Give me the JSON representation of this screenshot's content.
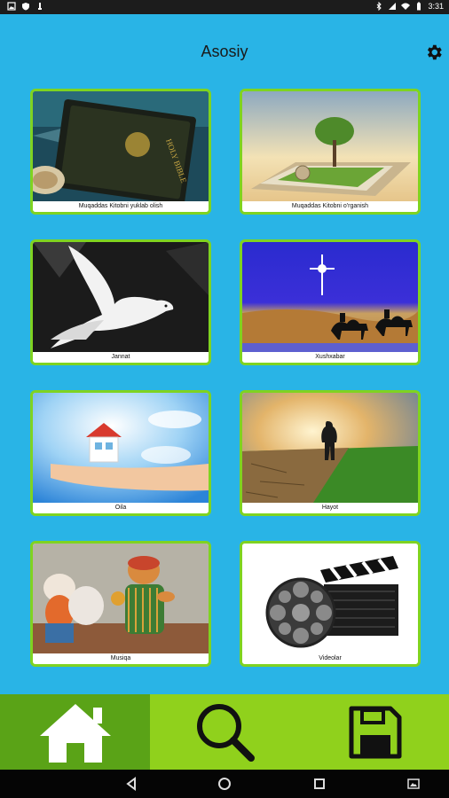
{
  "status_bar": {
    "time": "3:31",
    "left_icons": [
      "image-icon",
      "shield-icon",
      "notification-icon"
    ],
    "right_icons": [
      "bluetooth-icon",
      "signal-icon",
      "wifi-icon",
      "battery-icon"
    ]
  },
  "app_bar": {
    "title": "Asosiy",
    "settings_icon": "gear-icon"
  },
  "tiles": [
    {
      "caption": "Muqaddas Kitobni yuklab olish",
      "image": "bible-book"
    },
    {
      "caption": "Muqaddas Kitobni o'rganish",
      "image": "open-book-tree"
    },
    {
      "caption": "Jannat",
      "image": "white-dove"
    },
    {
      "caption": "Xushxabar",
      "image": "star-camels"
    },
    {
      "caption": "Oila",
      "image": "house-in-hand"
    },
    {
      "caption": "Hayot",
      "image": "man-in-sunlight"
    },
    {
      "caption": "Musiqa",
      "image": "figurines"
    },
    {
      "caption": "Videolar",
      "image": "film-reel-clapper"
    }
  ],
  "bottom_nav": [
    {
      "name": "home",
      "icon": "home-icon",
      "active": true
    },
    {
      "name": "search",
      "icon": "search-icon",
      "active": false
    },
    {
      "name": "save",
      "icon": "save-icon",
      "active": false
    }
  ],
  "system_nav": [
    "back-icon",
    "home-circle-icon",
    "recents-icon",
    "screenshot-icon"
  ],
  "colors": {
    "background": "#29b4e6",
    "tile_border": "#7fd321",
    "bottom_nav": "#90d11c",
    "bottom_nav_active": "#5aa317"
  }
}
